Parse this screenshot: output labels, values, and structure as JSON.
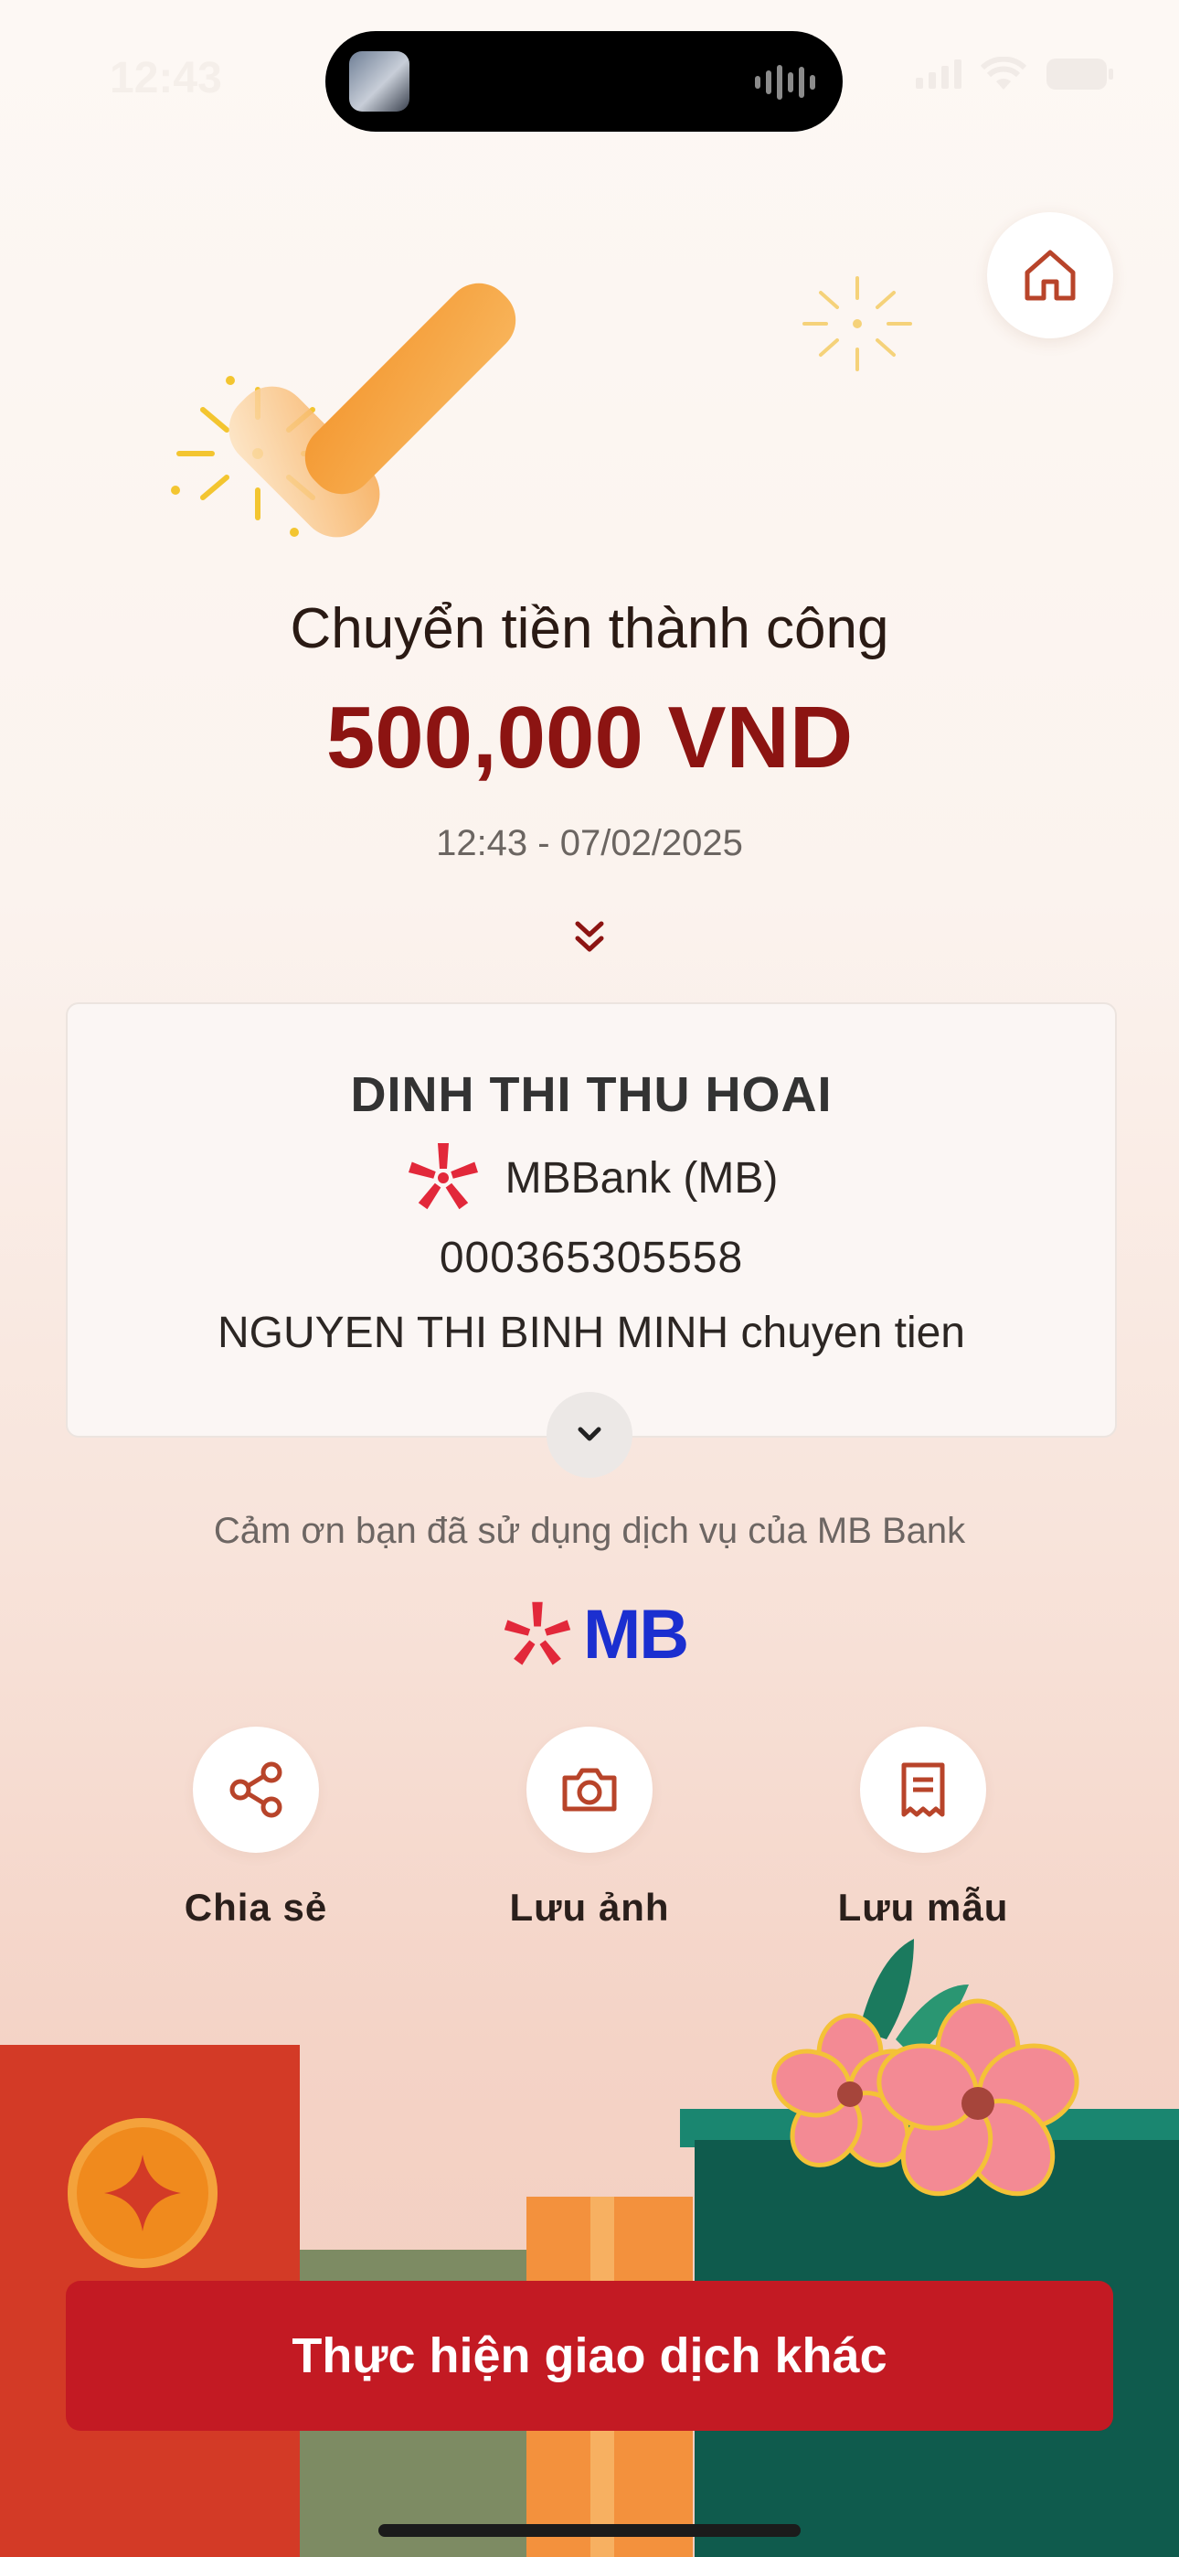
{
  "status_bar": {
    "time": "12:43"
  },
  "header": {
    "title": "Chuyển tiền thành công"
  },
  "transaction": {
    "amount": "500,000 VND",
    "datetime": "12:43 - 07/02/2025"
  },
  "recipient": {
    "name": "DINH THI THU HOAI",
    "bank": "MBBank (MB)",
    "account_number": "000365305558",
    "message": "NGUYEN THI BINH MINH chuyen tien"
  },
  "footer": {
    "thanks": "Cảm ơn bạn đã sử dụng dịch vụ của MB Bank",
    "logo_text": "MB"
  },
  "actions": [
    {
      "label": "Chia sẻ",
      "icon": "share-icon"
    },
    {
      "label": "Lưu ảnh",
      "icon": "camera-icon"
    },
    {
      "label": "Lưu mẫu",
      "icon": "receipt-icon"
    }
  ],
  "cta": {
    "label": "Thực hiện giao dịch khác"
  },
  "colors": {
    "accent": "#c31a23",
    "amount": "#8c1412",
    "icon": "#b8442a",
    "mb_blue": "#1b2fd0",
    "check_orange": "#f7a13a",
    "firework_yellow": "#f3c530"
  }
}
